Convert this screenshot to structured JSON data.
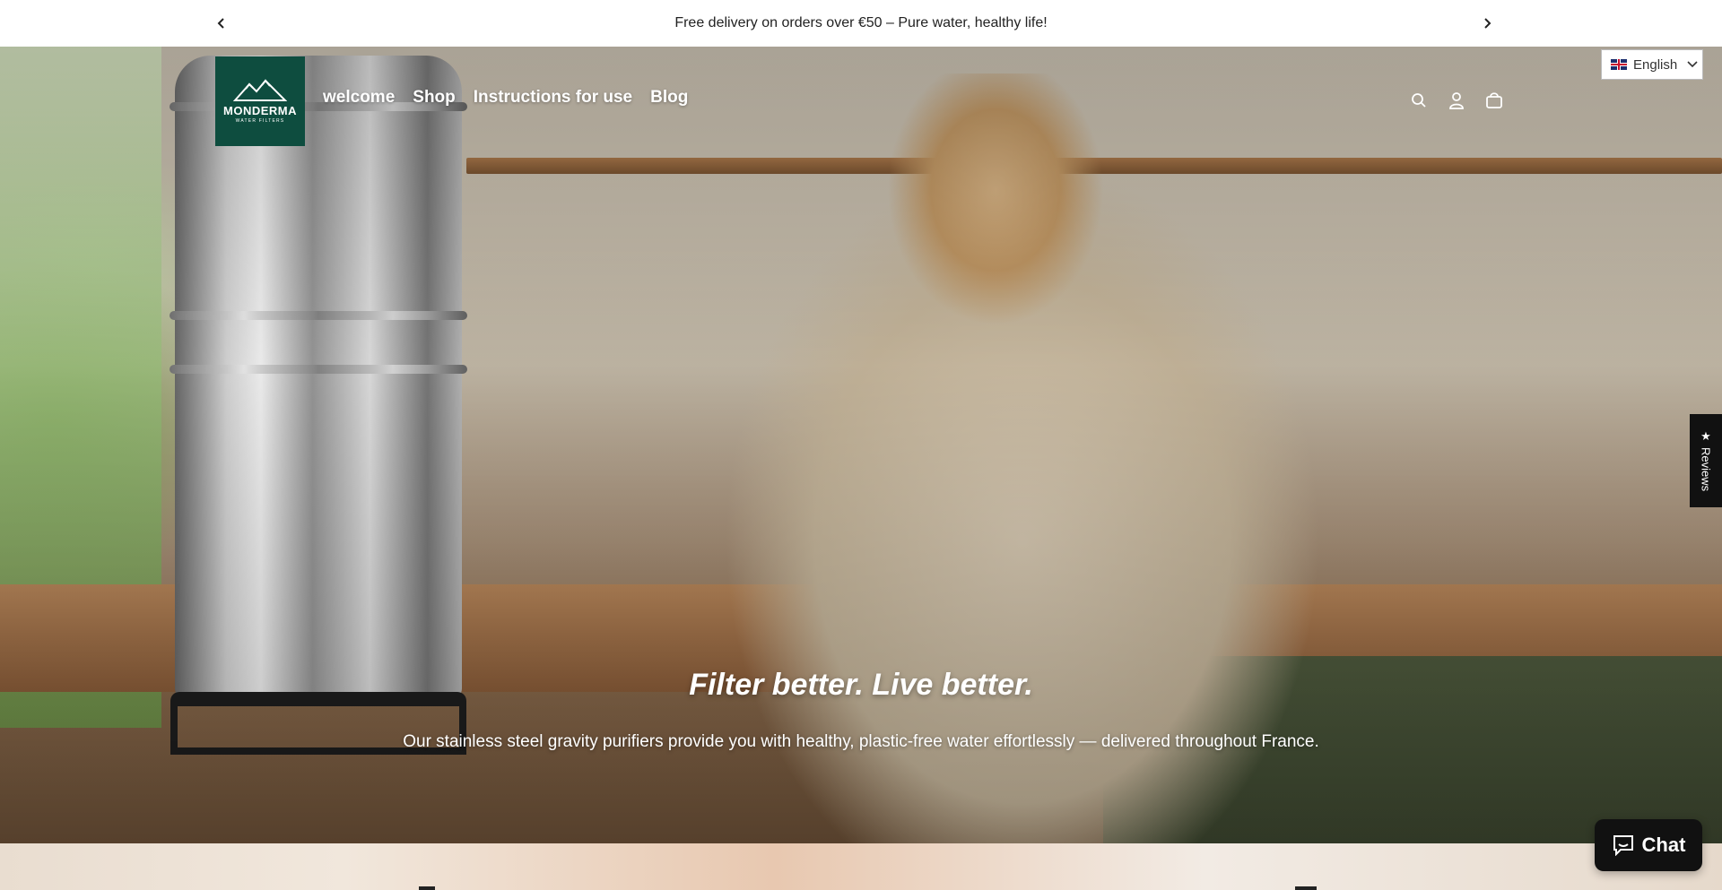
{
  "announcement": {
    "text": "Free delivery on orders over €50 – Pure water, healthy life!",
    "prev_icon": "chevron-left-icon",
    "next_icon": "chevron-right-icon"
  },
  "header": {
    "logo": {
      "brand": "MONDERMA",
      "tagline": "WATER FILTERS"
    },
    "nav": [
      {
        "label": "welcome"
      },
      {
        "label": "Shop"
      },
      {
        "label": "Instructions for use"
      },
      {
        "label": "Blog"
      }
    ],
    "icons": [
      "search-icon",
      "account-icon",
      "cart-icon"
    ]
  },
  "language": {
    "label": "English",
    "flag": "uk-flag-icon"
  },
  "hero": {
    "title": "Filter better. Live better.",
    "subtitle": "Our stainless steel gravity purifiers provide you with healthy, plastic-free water effortlessly — delivered throughout France."
  },
  "reviews_tab": {
    "label": "Reviews",
    "icon": "star-icon"
  },
  "chat": {
    "label": "Chat",
    "icon": "chat-bubble-icon"
  },
  "colors": {
    "brand": "#0e4d3f",
    "dark": "#111111",
    "text": "#222222"
  }
}
